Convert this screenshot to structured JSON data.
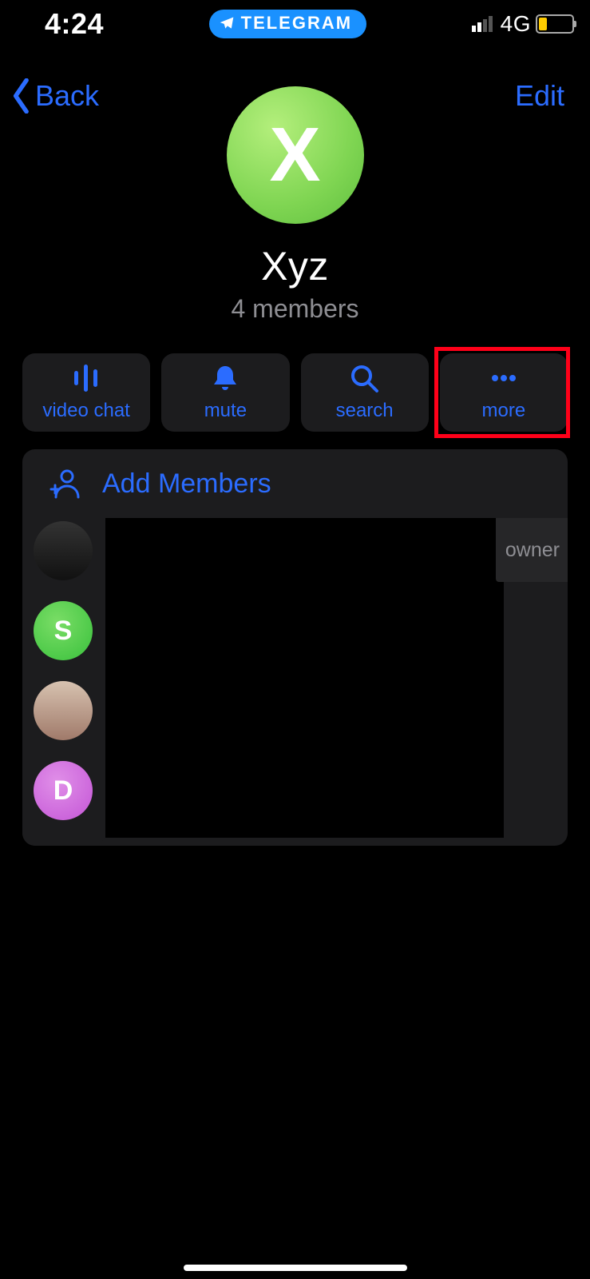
{
  "statusbar": {
    "time": "4:24",
    "app_pill": "TELEGRAM",
    "network": "4G"
  },
  "nav": {
    "back": "Back",
    "edit": "Edit"
  },
  "group": {
    "initial": "X",
    "name": "Xyz",
    "subtitle": "4 members"
  },
  "actions": {
    "voicechat": "video chat",
    "mute": "mute",
    "search": "search",
    "more": "more"
  },
  "members": {
    "add_label": "Add Members",
    "role_owner": "owner",
    "list": [
      {
        "initial": ""
      },
      {
        "initial": "S"
      },
      {
        "initial": ""
      },
      {
        "initial": "D"
      }
    ]
  }
}
